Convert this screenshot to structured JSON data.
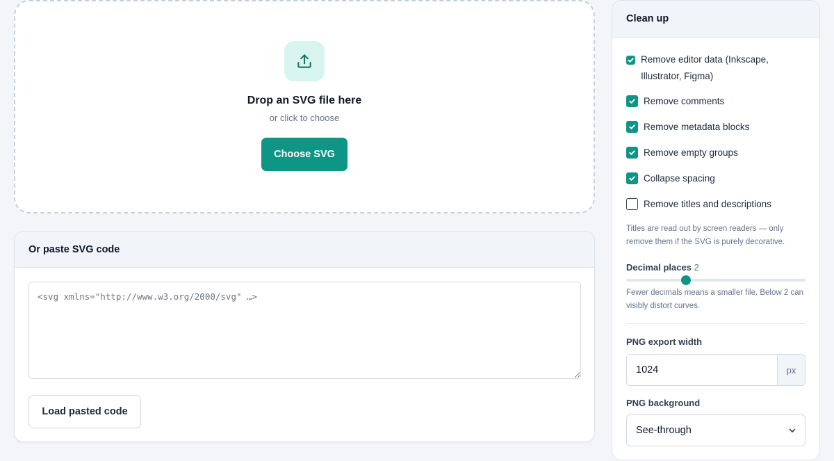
{
  "dropzone": {
    "icon": "upload-icon",
    "title": "Drop an SVG file here",
    "subtitle": "or click to choose",
    "button_label": "Choose SVG"
  },
  "paste": {
    "title": "Or paste SVG code",
    "placeholder": "<svg xmlns=\"http://www.w3.org/2000/svg\" …>",
    "value": "",
    "button_label": "Load pasted code"
  },
  "cleanup": {
    "title": "Clean up",
    "options": [
      {
        "label": "Remove editor data (Inkscape, Illustrator, Figma)",
        "checked": true
      },
      {
        "label": "Remove comments",
        "checked": true
      },
      {
        "label": "Remove metadata blocks",
        "checked": true
      },
      {
        "label": "Remove empty groups",
        "checked": true
      },
      {
        "label": "Collapse spacing",
        "checked": true
      },
      {
        "label": "Remove titles and descriptions",
        "checked": false
      }
    ],
    "titles_note": "Titles are read out by screen readers — only remove them if the SVG is purely decorative.",
    "decimal": {
      "label": "Decimal places",
      "value": "2",
      "min": 0,
      "max": 6,
      "note": "Fewer decimals means a smaller file. Below 2 can visibly distort curves."
    },
    "png_width": {
      "label": "PNG export width",
      "value": "1024",
      "unit": "px"
    },
    "png_background": {
      "label": "PNG background",
      "selected": "See-through"
    }
  },
  "colors": {
    "accent": "#0f9585",
    "accent_soft": "#d8f4ee",
    "page_bg": "#f3f5f9"
  }
}
